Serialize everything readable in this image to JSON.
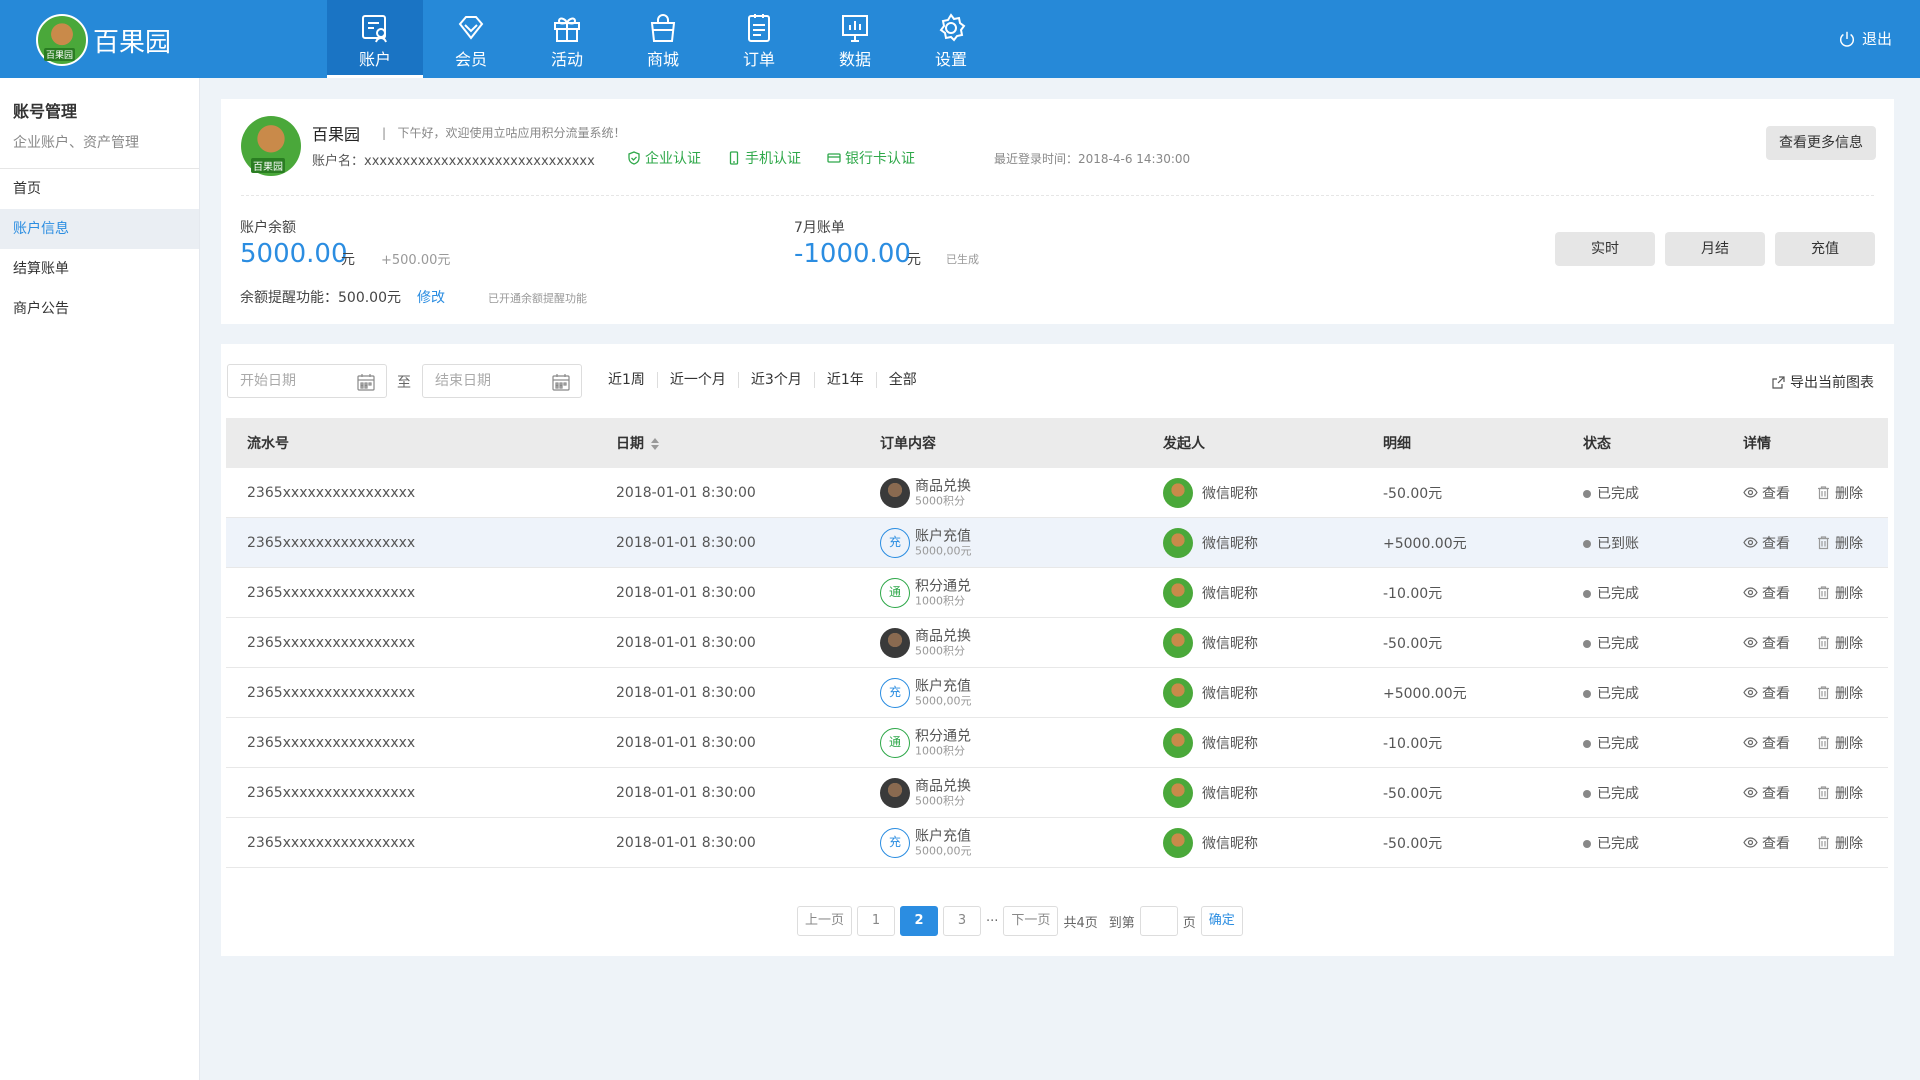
{
  "brand": {
    "name": "百果园"
  },
  "nav": [
    {
      "label": "账户",
      "icon": "account-icon",
      "active": true
    },
    {
      "label": "会员",
      "icon": "diamond-icon"
    },
    {
      "label": "活动",
      "icon": "gift-icon"
    },
    {
      "label": "商城",
      "icon": "shopping-bag-icon"
    },
    {
      "label": "订单",
      "icon": "order-list-icon"
    },
    {
      "label": "数据",
      "icon": "chart-icon"
    },
    {
      "label": "设置",
      "icon": "gear-icon"
    }
  ],
  "logout": "退出",
  "sidebar": {
    "title": "账号管理",
    "subtitle": "企业账户、资产管理",
    "items": [
      "首页",
      "账户信息",
      "结算账单",
      "商户公告"
    ],
    "active_index": 1
  },
  "account": {
    "name": "百果园",
    "greeting": "下午好，欢迎使用立咕应用积分流量系统！",
    "account_name_label": "账户名：xxxxxxxxxxxxxxxxxxxxxxxxxxxxxx",
    "certs": [
      "企业认证",
      "手机认证",
      "银行卡认证"
    ],
    "last_login": "最近登录时间：2018-4-6 14:30:00",
    "more_button": "查看更多信息",
    "balance_label": "账户余额",
    "balance_value": "5000.00",
    "balance_unit": "元",
    "balance_extra": "+500.00元",
    "bill_label": "7月账单",
    "bill_value": "-1000.00",
    "bill_unit": "元",
    "bill_status": "已生成",
    "remind_text": "余额提醒功能：500.00元",
    "remind_edit": "修改",
    "remind_note": "已开通余额提醒功能",
    "buttons": [
      "实时",
      "月结",
      "充值"
    ]
  },
  "filter": {
    "start_placeholder": "开始日期",
    "end_placeholder": "结束日期",
    "to_label": "至",
    "ranges": [
      "近1周",
      "近一个月",
      "近3个月",
      "近1年",
      "全部"
    ],
    "export": "导出当前图表"
  },
  "table": {
    "headers": [
      "流水号",
      "日期",
      "订单内容",
      "发起人",
      "明细",
      "状态",
      "详情"
    ],
    "rows": [
      {
        "serial": "2365xxxxxxxxxxxxxxxx",
        "date": "2018-01-01 8:30:00",
        "order_type": "photo",
        "order_title": "商品兑换",
        "order_sub": "5000积分",
        "user": "微信昵称",
        "detail": "-50.00元",
        "status": "已完成",
        "view": "查看",
        "delete": "删除"
      },
      {
        "serial": "2365xxxxxxxxxxxxxxxx",
        "date": "2018-01-01 8:30:00",
        "order_type": "chong",
        "order_badge": "充",
        "order_title": "账户充值",
        "order_sub": "5000,00元",
        "user": "微信昵称",
        "detail": "+5000.00元",
        "status": "已到账",
        "view": "查看",
        "delete": "删除"
      },
      {
        "serial": "2365xxxxxxxxxxxxxxxx",
        "date": "2018-01-01 8:30:00",
        "order_type": "tong",
        "order_badge": "通",
        "order_title": "积分通兑",
        "order_sub": "1000积分",
        "user": "微信昵称",
        "detail": "-10.00元",
        "status": "已完成",
        "view": "查看",
        "delete": "删除"
      },
      {
        "serial": "2365xxxxxxxxxxxxxxxx",
        "date": "2018-01-01 8:30:00",
        "order_type": "photo",
        "order_title": "商品兑换",
        "order_sub": "5000积分",
        "user": "微信昵称",
        "detail": "-50.00元",
        "status": "已完成",
        "view": "查看",
        "delete": "删除"
      },
      {
        "serial": "2365xxxxxxxxxxxxxxxx",
        "date": "2018-01-01 8:30:00",
        "order_type": "chong",
        "order_badge": "充",
        "order_title": "账户充值",
        "order_sub": "5000,00元",
        "user": "微信昵称",
        "detail": "+5000.00元",
        "status": "已完成",
        "view": "查看",
        "delete": "删除"
      },
      {
        "serial": "2365xxxxxxxxxxxxxxxx",
        "date": "2018-01-01 8:30:00",
        "order_type": "tong",
        "order_badge": "通",
        "order_title": "积分通兑",
        "order_sub": "1000积分",
        "user": "微信昵称",
        "detail": "-10.00元",
        "status": "已完成",
        "view": "查看",
        "delete": "删除"
      },
      {
        "serial": "2365xxxxxxxxxxxxxxxx",
        "date": "2018-01-01 8:30:00",
        "order_type": "photo",
        "order_title": "商品兑换",
        "order_sub": "5000积分",
        "user": "微信昵称",
        "detail": "-50.00元",
        "status": "已完成",
        "view": "查看",
        "delete": "删除"
      },
      {
        "serial": "2365xxxxxxxxxxxxxxxx",
        "date": "2018-01-01 8:30:00",
        "order_type": "chong",
        "order_badge": "充",
        "order_title": "账户充值",
        "order_sub": "5000,00元",
        "user": "微信昵称",
        "detail": "-50.00元",
        "status": "已完成",
        "view": "查看",
        "delete": "删除"
      }
    ],
    "highlight_row": 1
  },
  "pagination": {
    "prev": "上一页",
    "pages": [
      "1",
      "2",
      "3"
    ],
    "current": "2",
    "ellipsis": "···",
    "next": "下一页",
    "total": "共4页",
    "goto": "到第",
    "page_unit": "页",
    "confirm": "确定"
  },
  "colors": {
    "primary": "#2689d8",
    "accent": "#2b8de1",
    "success": "#2fa84a"
  }
}
